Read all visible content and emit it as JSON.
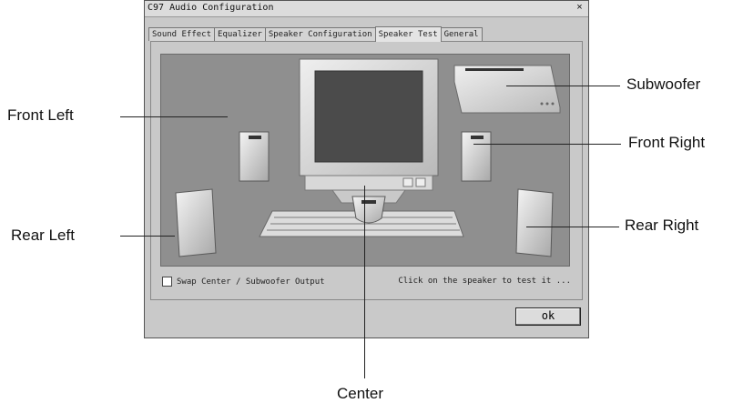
{
  "window": {
    "title": "C97 Audio Configuration",
    "close_glyph": "×"
  },
  "tabs": [
    {
      "label": "Sound Effect",
      "active": false
    },
    {
      "label": "Equalizer",
      "active": false
    },
    {
      "label": "Speaker Configuration",
      "active": false
    },
    {
      "label": "Speaker Test",
      "active": true
    },
    {
      "label": "General",
      "active": false
    }
  ],
  "speaker_test": {
    "swap_checkbox_label": "Swap Center / Subwoofer Output",
    "swap_checked": false,
    "hint": "Click on the speaker to test it ..."
  },
  "ok_button": "ok",
  "callouts": {
    "front_left": "Front Left",
    "rear_left": "Rear Left",
    "subwoofer": "Subwoofer",
    "front_right": "Front Right",
    "rear_right": "Rear Right",
    "center": "Center"
  },
  "colors": {
    "stage": "#8f8f8f",
    "window": "#c9c9c9"
  }
}
